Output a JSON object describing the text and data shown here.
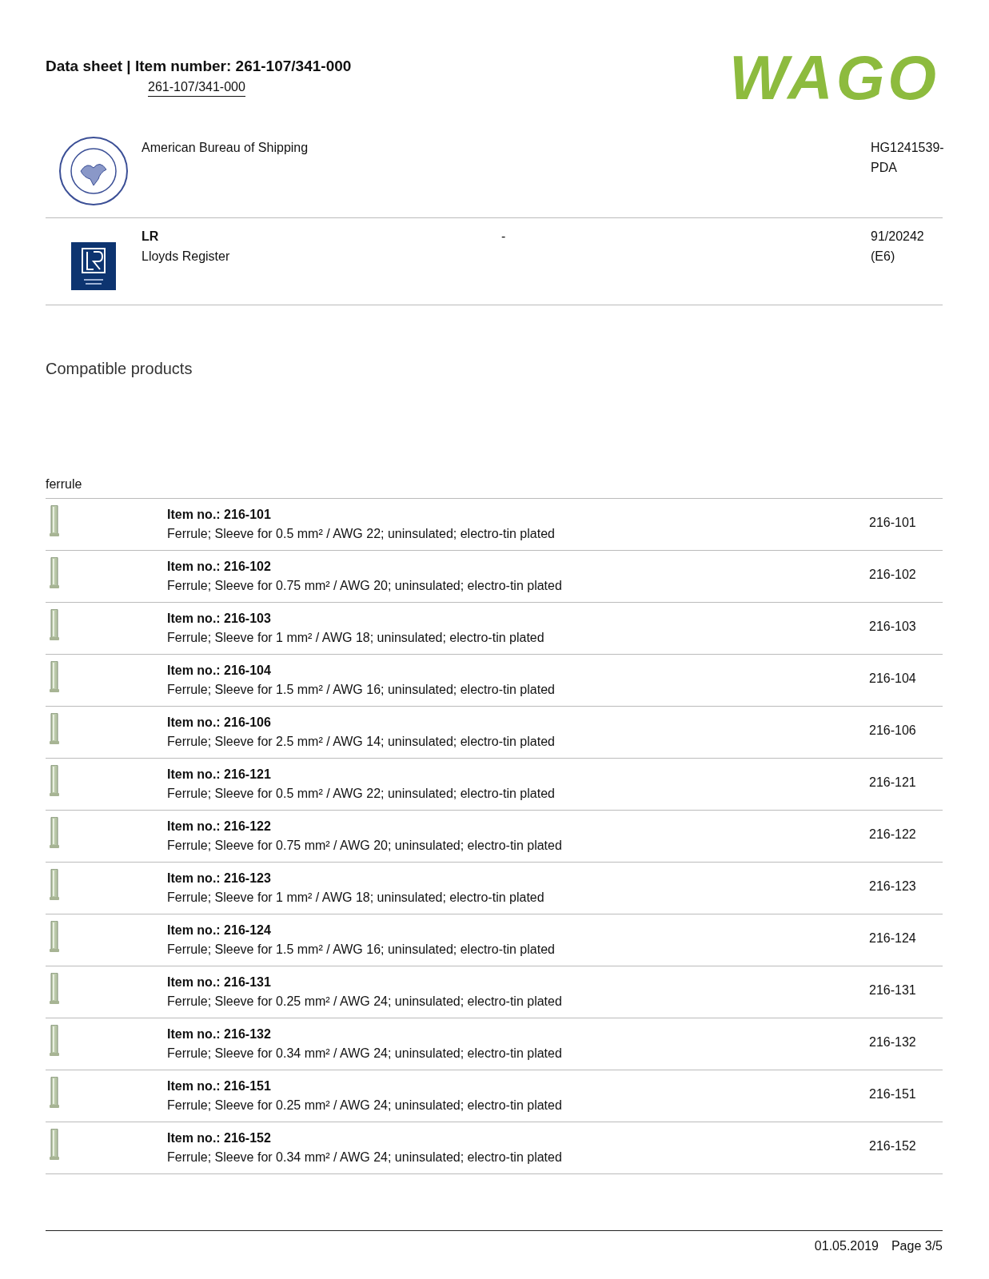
{
  "header": {
    "title": "Data sheet | Item number: 261-107/341-000",
    "item_link": "261-107/341-000",
    "logo": "WAGO"
  },
  "certifications": [
    {
      "kind": "abs",
      "body": "American Bureau of Shipping",
      "number": "HG1241539-PDA"
    },
    {
      "kind": "lr",
      "title": "LR",
      "body": "Lloyds Register",
      "note": "-",
      "number": "91/20242 (E6)"
    }
  ],
  "section_title": "Compatible products",
  "group": {
    "label": "ferrule",
    "items": [
      {
        "item": "Item no.: 216-101",
        "desc": "Ferrule; Sleeve for 0.5 mm² / AWG 22; uninsulated; electro-tin plated",
        "number": "216-101"
      },
      {
        "item": "Item no.: 216-102",
        "desc": "Ferrule; Sleeve for 0.75 mm² / AWG 20; uninsulated; electro-tin plated",
        "number": "216-102"
      },
      {
        "item": "Item no.: 216-103",
        "desc": "Ferrule; Sleeve for 1 mm² / AWG 18; uninsulated; electro-tin plated",
        "number": "216-103"
      },
      {
        "item": "Item no.: 216-104",
        "desc": "Ferrule; Sleeve for 1.5 mm² / AWG 16; uninsulated; electro-tin plated",
        "number": "216-104"
      },
      {
        "item": "Item no.: 216-106",
        "desc": "Ferrule; Sleeve for 2.5 mm² / AWG 14; uninsulated; electro-tin plated",
        "number": "216-106"
      },
      {
        "item": "Item no.: 216-121",
        "desc": "Ferrule; Sleeve for 0.5 mm² / AWG 22; uninsulated; electro-tin plated",
        "number": "216-121"
      },
      {
        "item": "Item no.: 216-122",
        "desc": "Ferrule; Sleeve for 0.75 mm² / AWG 20; uninsulated; electro-tin plated",
        "number": "216-122"
      },
      {
        "item": "Item no.: 216-123",
        "desc": "Ferrule; Sleeve for 1 mm² / AWG 18; uninsulated; electro-tin plated",
        "number": "216-123"
      },
      {
        "item": "Item no.: 216-124",
        "desc": "Ferrule; Sleeve for 1.5 mm² / AWG 16; uninsulated; electro-tin plated",
        "number": "216-124"
      },
      {
        "item": "Item no.: 216-131",
        "desc": "Ferrule; Sleeve for 0.25 mm² / AWG 24; uninsulated; electro-tin plated",
        "number": "216-131"
      },
      {
        "item": "Item no.: 216-132",
        "desc": "Ferrule; Sleeve for 0.34 mm² / AWG 24; uninsulated; electro-tin plated",
        "number": "216-132"
      },
      {
        "item": "Item no.: 216-151",
        "desc": "Ferrule; Sleeve for 0.25 mm² / AWG 24; uninsulated; electro-tin plated",
        "number": "216-151"
      },
      {
        "item": "Item no.: 216-152",
        "desc": "Ferrule; Sleeve for 0.34 mm² / AWG 24; uninsulated; electro-tin plated",
        "number": "216-152"
      }
    ]
  },
  "footer": {
    "date": "01.05.2019",
    "page": "Page 3/5"
  }
}
